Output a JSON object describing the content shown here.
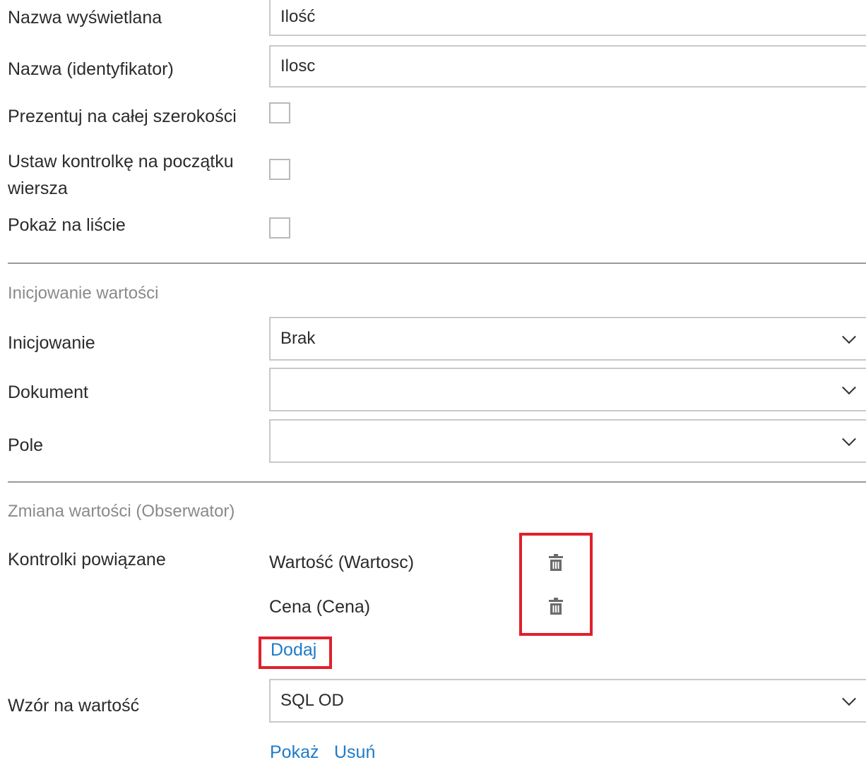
{
  "form": {
    "display_name": {
      "label": "Nazwa wyświetlana",
      "value": "Ilość"
    },
    "identifier": {
      "label": "Nazwa (identyfikator)",
      "value": "Ilosc"
    },
    "full_width": {
      "label": "Prezentuj na całej szerokości",
      "checked": false
    },
    "row_start": {
      "label": "Ustaw kontrolkę na początku wiersza",
      "checked": false
    },
    "show_on_list": {
      "label": "Pokaż na liście",
      "checked": false
    }
  },
  "init_section": {
    "title": "Inicjowanie wartości",
    "initialization": {
      "label": "Inicjowanie",
      "value": "Brak"
    },
    "document": {
      "label": "Dokument",
      "value": ""
    },
    "field": {
      "label": "Pole",
      "value": ""
    }
  },
  "observer_section": {
    "title": "Zmiana wartości (Obserwator)",
    "related_label": "Kontrolki powiązane",
    "related_items": [
      {
        "label": "Wartość (Wartosc)",
        "icon": "trash-icon"
      },
      {
        "label": "Cena (Cena)",
        "icon": "trash-icon"
      }
    ],
    "add_link": "Dodaj",
    "formula": {
      "label": "Wzór na wartość",
      "value": "SQL OD"
    },
    "show_link": "Pokaż",
    "remove_link": "Usuń"
  },
  "colors": {
    "link": "#1e7cc8",
    "highlight": "#e0202c",
    "section_title": "#8a8a8a"
  }
}
